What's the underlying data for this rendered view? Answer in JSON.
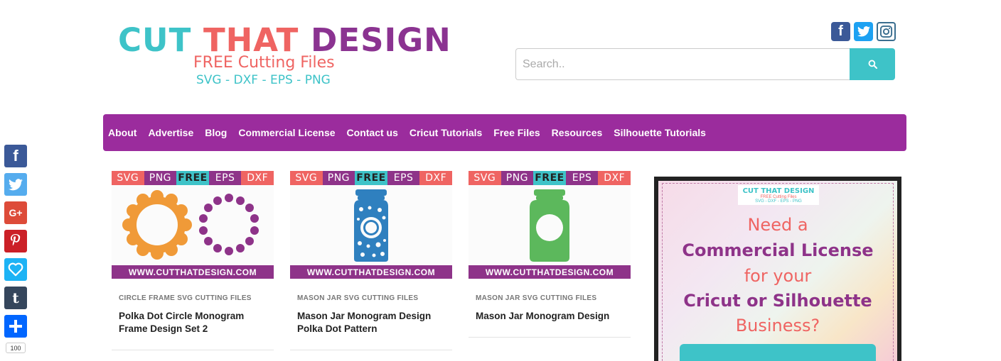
{
  "logo": {
    "word1": "CUT",
    "word2": "THAT",
    "word3": "DESIGN",
    "tagline": "FREE Cutting Files",
    "formats": "SVG - DXF - EPS - PNG"
  },
  "social": {
    "facebook": "f",
    "twitter": "twitter",
    "instagram": "instagram"
  },
  "search": {
    "placeholder": "Search.."
  },
  "nav": {
    "items": [
      "About",
      "Advertise",
      "Blog",
      "Commercial License",
      "Contact us",
      "Cricut Tutorials",
      "Free Files",
      "Resources",
      "Silhouette Tutorials"
    ]
  },
  "banner_labels": [
    "SVG",
    "PNG",
    "FREE",
    "EPS",
    "DXF"
  ],
  "banner_colors": [
    "#ef6462",
    "#8e3389",
    "#3ec3c8",
    "#8e3389",
    "#ef6462"
  ],
  "site_url": "WWW.CUTTHATDESIGN.COM",
  "cards": [
    {
      "category": "CIRCLE FRAME SVG CUTTING FILES",
      "title": "Polka Dot Circle Monogram Frame Design Set 2"
    },
    {
      "category": "MASON JAR SVG CUTTING FILES",
      "title": "Mason Jar Monogram Design Polka Dot Pattern"
    },
    {
      "category": "MASON JAR SVG CUTTING FILES",
      "title": "Mason Jar Monogram Design"
    }
  ],
  "ad": {
    "logo_title": "CUT THAT DESIGN",
    "logo_sub": "FREE Cutting Files",
    "logo_formats": "SVG - DXF - EPS - PNG",
    "line1": "Need a",
    "line2": "Commercial License",
    "line3": "for your",
    "line4": "Cricut or Silhouette",
    "line5": "Business?"
  },
  "share": {
    "count": "100",
    "google": "G+",
    "tumblr": "t",
    "facebook": "f"
  },
  "colors": {
    "purple": "#9b2c9d",
    "teal": "#3ec3c8",
    "coral": "#ef6462",
    "orange": "#f09a38",
    "blue": "#2f80bf",
    "green": "#5cb85c"
  }
}
